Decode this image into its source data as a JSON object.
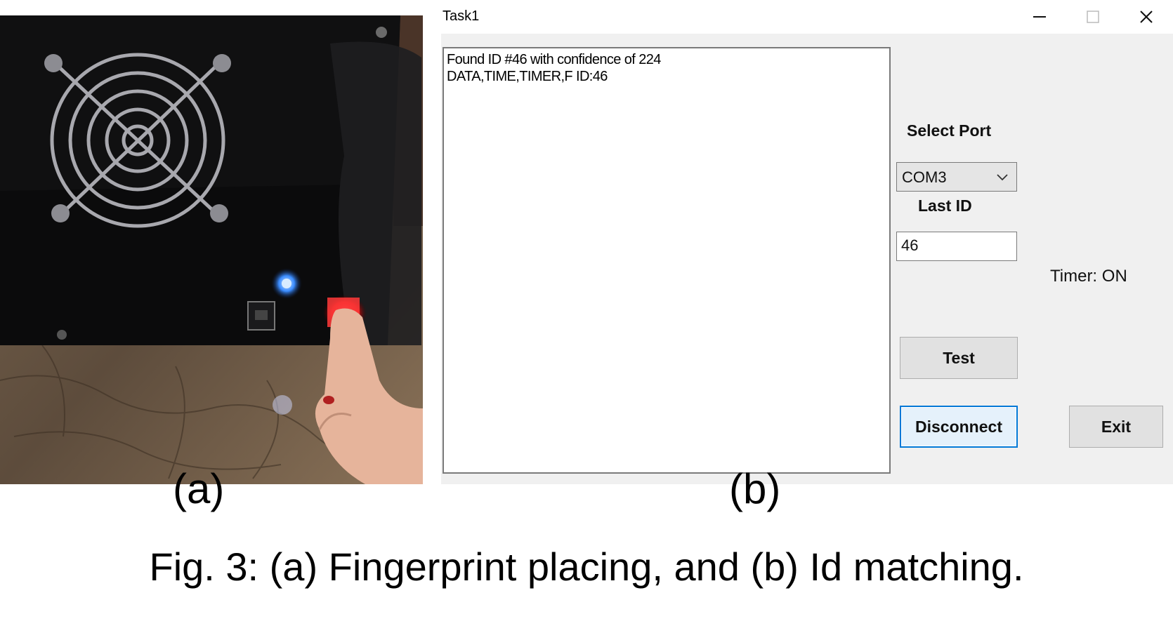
{
  "window": {
    "title": "Task1",
    "controls": [
      "minimize",
      "maximize",
      "close"
    ]
  },
  "log": {
    "lines": [
      "Found ID #46 with confidence of 224",
      "DATA,TIME,TIMER,F ID:46"
    ]
  },
  "port": {
    "label": "Select Port",
    "selected": "COM3"
  },
  "last_id": {
    "label": "Last ID",
    "value": "46"
  },
  "timer_status": "Timer: ON",
  "buttons": {
    "test": "Test",
    "disconnect": "Disconnect",
    "exit": "Exit"
  },
  "captions": {
    "panel_a": "(a)",
    "panel_b": "(b)",
    "figure": "Fig. 3: (a) Fingerprint placing, and (b) Id matching."
  },
  "colors": {
    "focus_border": "#0078d7",
    "client_bg": "#f0f0f0"
  }
}
